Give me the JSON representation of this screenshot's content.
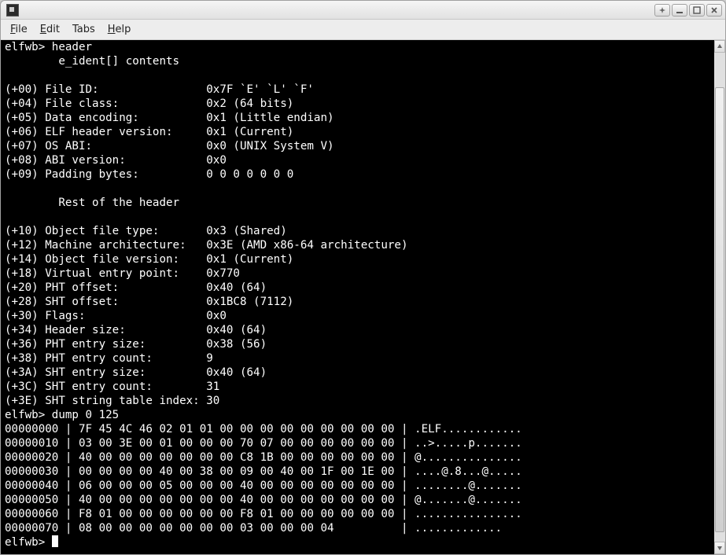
{
  "menubar": {
    "file": "File",
    "edit": "Edit",
    "tabs": "Tabs",
    "help": "Help"
  },
  "terminal": {
    "prompt": "elfwb>",
    "cmd_header": "header",
    "section1": "        e_ident[] contents",
    "blank": "",
    "h00": "(+00) File ID:                0x7F `E' `L' `F'",
    "h04": "(+04) File class:             0x2 (64 bits)",
    "h05": "(+05) Data encoding:          0x1 (Little endian)",
    "h06": "(+06) ELF header version:     0x1 (Current)",
    "h07": "(+07) OS ABI:                 0x0 (UNIX System V)",
    "h08": "(+08) ABI version:            0x0",
    "h09": "(+09) Padding bytes:          0 0 0 0 0 0 0",
    "section2": "        Rest of the header",
    "h10": "(+10) Object file type:       0x3 (Shared)",
    "h12": "(+12) Machine architecture:   0x3E (AMD x86-64 architecture)",
    "h14": "(+14) Object file version:    0x1 (Current)",
    "h18": "(+18) Virtual entry point:    0x770",
    "h20": "(+20) PHT offset:             0x40 (64)",
    "h28": "(+28) SHT offset:             0x1BC8 (7112)",
    "h30": "(+30) Flags:                  0x0",
    "h34": "(+34) Header size:            0x40 (64)",
    "h36": "(+36) PHT entry size:         0x38 (56)",
    "h38": "(+38) PHT entry count:        9",
    "h3A": "(+3A) SHT entry size:         0x40 (64)",
    "h3C": "(+3C) SHT entry count:        31",
    "h3E": "(+3E) SHT string table index: 30",
    "cmd_dump": "dump 0 125",
    "d00": "00000000 | 7F 45 4C 46 02 01 01 00 00 00 00 00 00 00 00 00 | .ELF............",
    "d10": "00000010 | 03 00 3E 00 01 00 00 00 70 07 00 00 00 00 00 00 | ..>.....p.......",
    "d20": "00000020 | 40 00 00 00 00 00 00 00 C8 1B 00 00 00 00 00 00 | @...............",
    "d30": "00000030 | 00 00 00 00 40 00 38 00 09 00 40 00 1F 00 1E 00 | ....@.8...@.....",
    "d40": "00000040 | 06 00 00 00 05 00 00 00 40 00 00 00 00 00 00 00 | ........@.......",
    "d50": "00000050 | 40 00 00 00 00 00 00 00 40 00 00 00 00 00 00 00 | @.......@.......",
    "d60": "00000060 | F8 01 00 00 00 00 00 00 F8 01 00 00 00 00 00 00 | ................",
    "d70": "00000070 | 08 00 00 00 00 00 00 00 03 00 00 00 04          | .............",
    "final_prompt": "elfwb> "
  },
  "scrollbar": {
    "thumb_top_pct": 7,
    "thumb_height_pct": 91
  }
}
